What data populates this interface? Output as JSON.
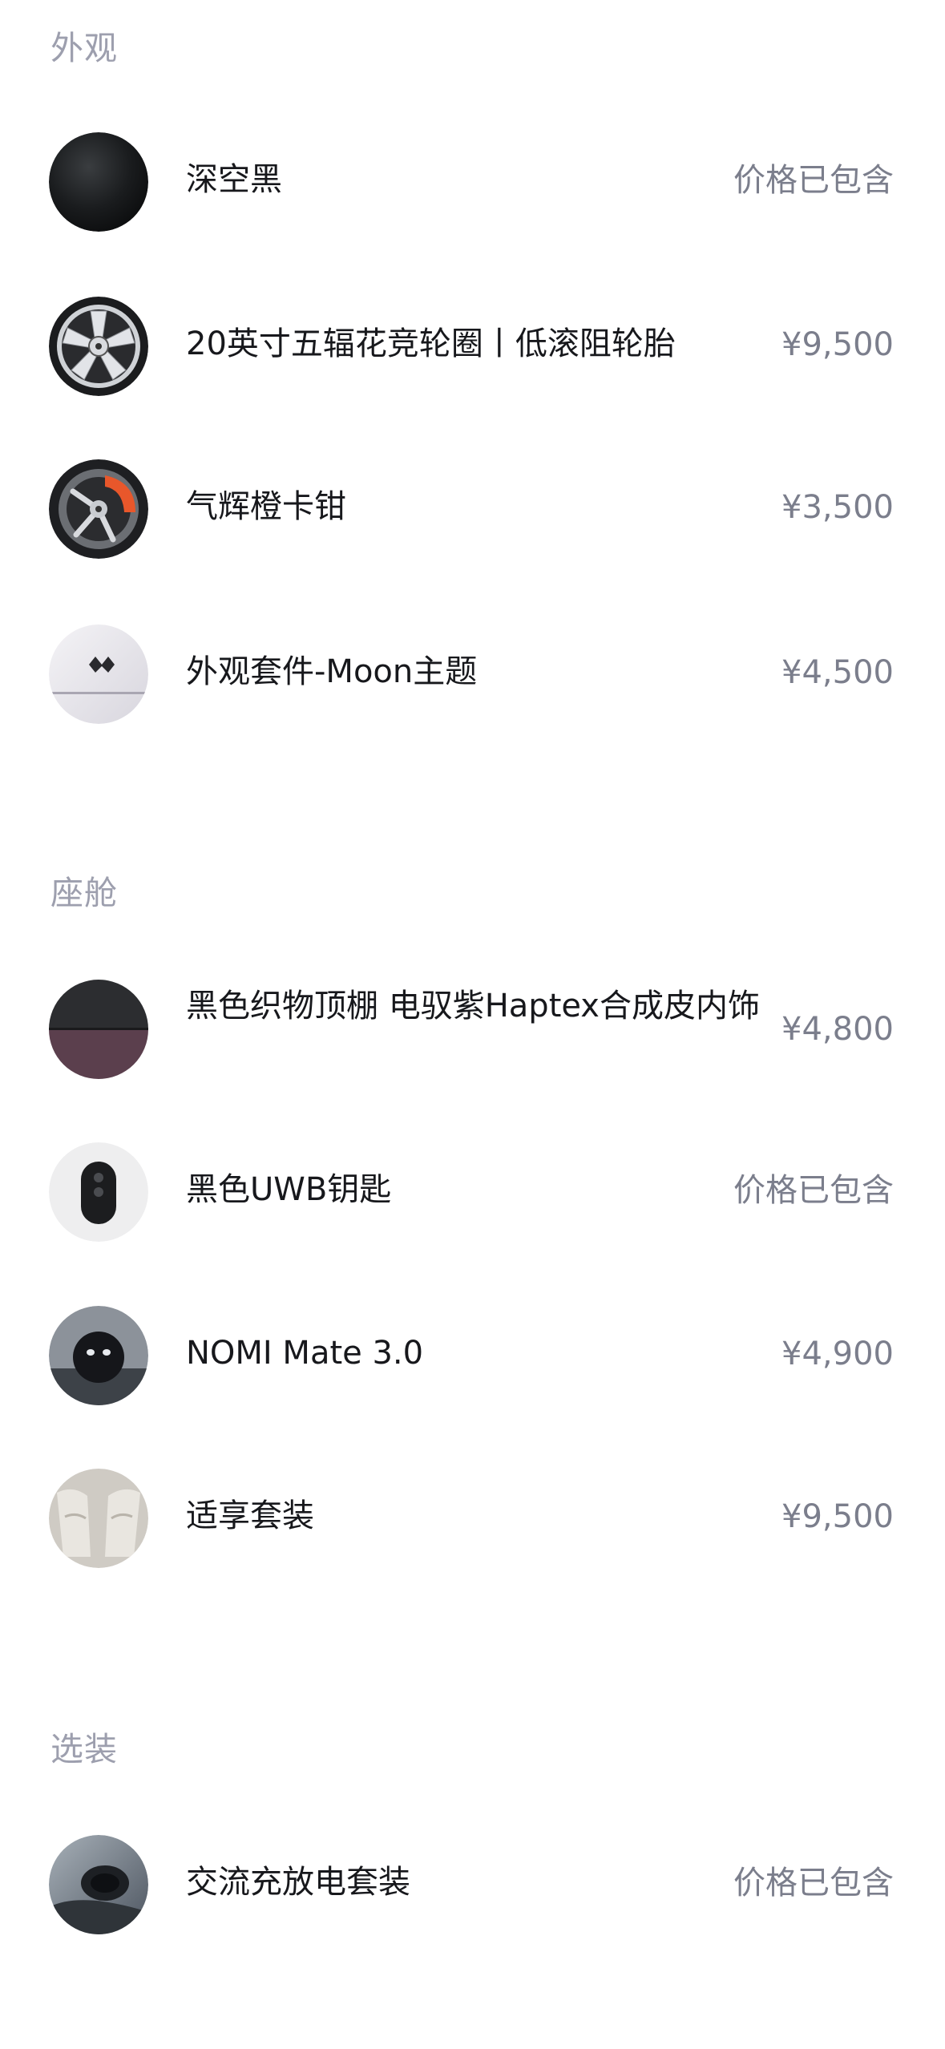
{
  "sections": {
    "exterior": {
      "title": "外观",
      "items": [
        {
          "name": "深空黑",
          "price": "价格已包含",
          "icon": "black-paint-swatch"
        },
        {
          "name": "20英寸五辐花竞轮圈丨低滚阻轮胎",
          "price": "¥9,500",
          "icon": "wheel-rim"
        },
        {
          "name": "气辉橙卡钳",
          "price": "¥3,500",
          "icon": "orange-caliper"
        },
        {
          "name": "外观套件-Moon主题",
          "price": "¥4,500",
          "icon": "moon-theme-logo"
        }
      ]
    },
    "cabin": {
      "title": "座舱",
      "items": [
        {
          "name": "黑色织物顶棚 电驭紫Haptex合成皮内饰",
          "price": "¥4,800",
          "icon": "fabric-swatch"
        },
        {
          "name": "黑色UWB钥匙",
          "price": "价格已包含",
          "icon": "uwb-key-fob"
        },
        {
          "name": "NOMI Mate 3.0",
          "price": "¥4,900",
          "icon": "nomi-robot"
        },
        {
          "name": "适享套装",
          "price": "¥9,500",
          "icon": "seat-package"
        }
      ]
    },
    "options": {
      "title": "选装",
      "items": [
        {
          "name": "交流充放电套装",
          "price": "价格已包含",
          "icon": "charging-port"
        }
      ]
    }
  },
  "colors": {
    "section_title": "#9d9fae",
    "item_name": "#17181c",
    "price": "#7b7e8c",
    "caliper_orange": "#e8572b"
  }
}
